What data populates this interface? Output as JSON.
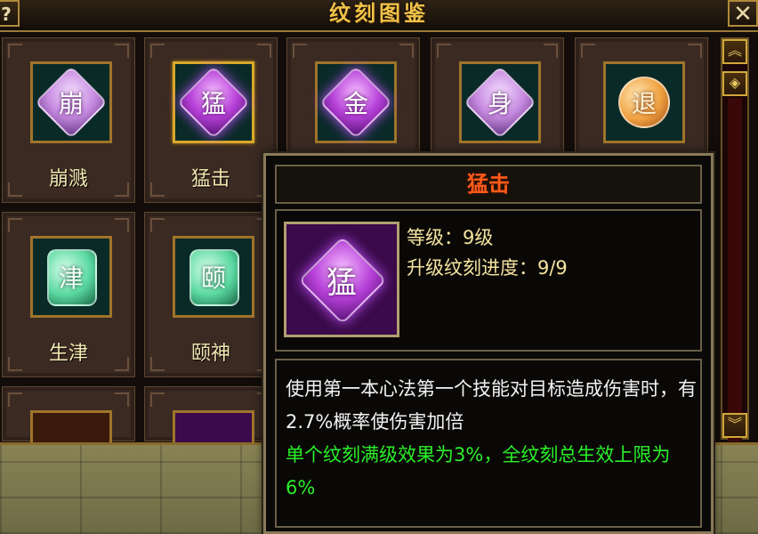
{
  "window": {
    "title": "纹刻图鉴",
    "help_label": "?",
    "close_label": "✕"
  },
  "grid": {
    "cells": [
      {
        "label": "崩溅",
        "glyph": "崩",
        "style": "pink"
      },
      {
        "label": "猛击",
        "glyph": "猛",
        "style": "purple"
      },
      {
        "label": "",
        "glyph": "金",
        "style": "purple"
      },
      {
        "label": "",
        "glyph": "身",
        "style": "pink"
      },
      {
        "label": "",
        "glyph": "退",
        "style": "orange"
      },
      {
        "label": "生津",
        "glyph": "津",
        "style": "green"
      },
      {
        "label": "颐神",
        "glyph": "颐",
        "style": "green"
      }
    ]
  },
  "scrollbar": {
    "up_icon": "double-chevron-up-icon",
    "thumb_icon": "diamond-icon",
    "down_icon": "double-chevron-down-icon"
  },
  "tooltip": {
    "title": "猛击",
    "glyph": "猛",
    "level_line": "等级：9级",
    "progress_line": "升级纹刻进度：9/9",
    "description": "使用第一本心法第一个技能对目标造成伤害时，有2.7%概率使伤害加倍",
    "bonus": "单个纹刻满级效果为3%，全纹刻总生效上限为6%"
  },
  "colors": {
    "title_gold": "#f0c24a",
    "tooltip_title": "#ff5a1a",
    "bonus_green": "#2af02a",
    "label_text": "#f2e6b0"
  }
}
